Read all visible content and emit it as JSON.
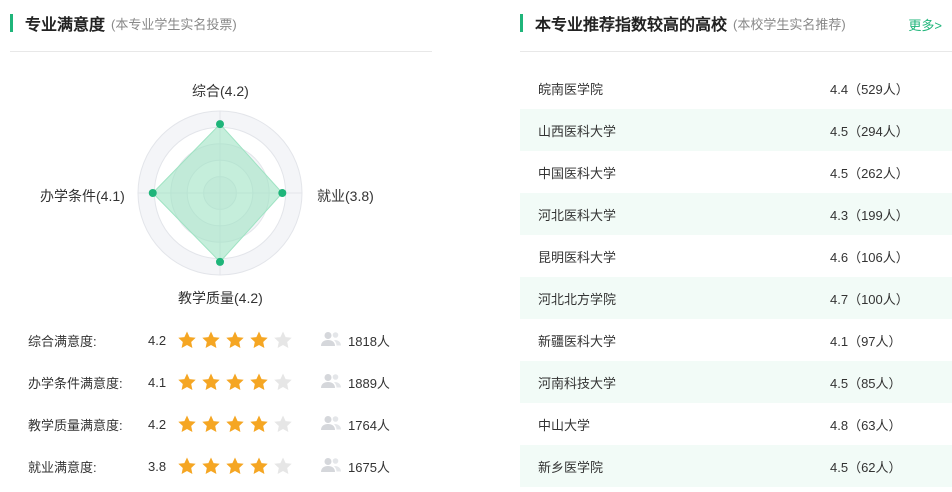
{
  "satisfaction": {
    "title": "专业满意度",
    "subtitle": "(本专业学生实名投票)",
    "radar": {
      "labels": {
        "top": "综合(4.2)",
        "right": "就业(3.8)",
        "bottom": "教学质量(4.2)",
        "left": "办学条件(4.1)"
      },
      "values": {
        "top": 4.2,
        "right": 3.8,
        "bottom": 4.2,
        "left": 4.1
      },
      "max": 5,
      "fill_color": "#9fe3c3",
      "point_color": "#1fb57a"
    },
    "ratings": [
      {
        "label": "综合满意度:",
        "score": "4.2",
        "value": 4.2,
        "count": "1818人"
      },
      {
        "label": "办学条件满意度:",
        "score": "4.1",
        "value": 4.1,
        "count": "1889人"
      },
      {
        "label": "教学质量满意度:",
        "score": "4.2",
        "value": 4.2,
        "count": "1764人"
      },
      {
        "label": "就业满意度:",
        "score": "3.8",
        "value": 3.8,
        "count": "1675人"
      }
    ],
    "star_color": "#f5a623",
    "star_empty_color": "#e6e6e6",
    "people_icon": "people-icon"
  },
  "recommend": {
    "title": "本专业推荐指数较高的高校",
    "subtitle": "(本校学生实名推荐)",
    "more_label": "更多>",
    "schools": [
      {
        "name": "皖南医学院",
        "score": "4.4（529人）"
      },
      {
        "name": "山西医科大学",
        "score": "4.5（294人）"
      },
      {
        "name": "中国医科大学",
        "score": "4.5（262人）"
      },
      {
        "name": "河北医科大学",
        "score": "4.3（199人）"
      },
      {
        "name": "昆明医科大学",
        "score": "4.6（106人）"
      },
      {
        "name": "河北北方学院",
        "score": "4.7（100人）"
      },
      {
        "name": "新疆医科大学",
        "score": "4.1（97人）"
      },
      {
        "name": "河南科技大学",
        "score": "4.5（85人）"
      },
      {
        "name": "中山大学",
        "score": "4.8（63人）"
      },
      {
        "name": "新乡医学院",
        "score": "4.5（62人）"
      }
    ]
  }
}
